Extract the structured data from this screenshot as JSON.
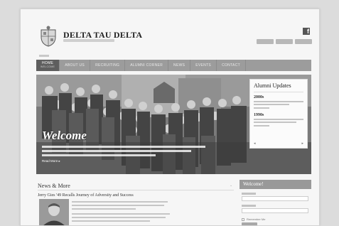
{
  "site": {
    "name": "DELTA TAU DELTA"
  },
  "social": {
    "icon": "facebook-icon",
    "glyph": "f"
  },
  "nav": {
    "active": {
      "label": "HOME",
      "sub": "Welcome"
    },
    "items": [
      "ABOUT US",
      "RECRUITING",
      "ALUMNI CORNER",
      "NEWS",
      "EVENTS",
      "CONTACT"
    ]
  },
  "hero": {
    "heading": "Welcome",
    "read_more": "Read More ▸"
  },
  "alumni": {
    "title": "Alumni Updates",
    "entries": [
      {
        "year": "2000s"
      },
      {
        "year": "1990s"
      }
    ],
    "prev": "◂",
    "next": "▸"
  },
  "news": {
    "heading": "News & More",
    "article_title": "Jerry Gies '49 Recalls Journey of Adversity and Success"
  },
  "sidebar": {
    "heading": "Welcome!",
    "remember": "Remember Me"
  },
  "colors": {
    "nav_bg": "#9c9c9c",
    "nav_active": "#5e5e5e",
    "sidebar_head": "#999999"
  }
}
